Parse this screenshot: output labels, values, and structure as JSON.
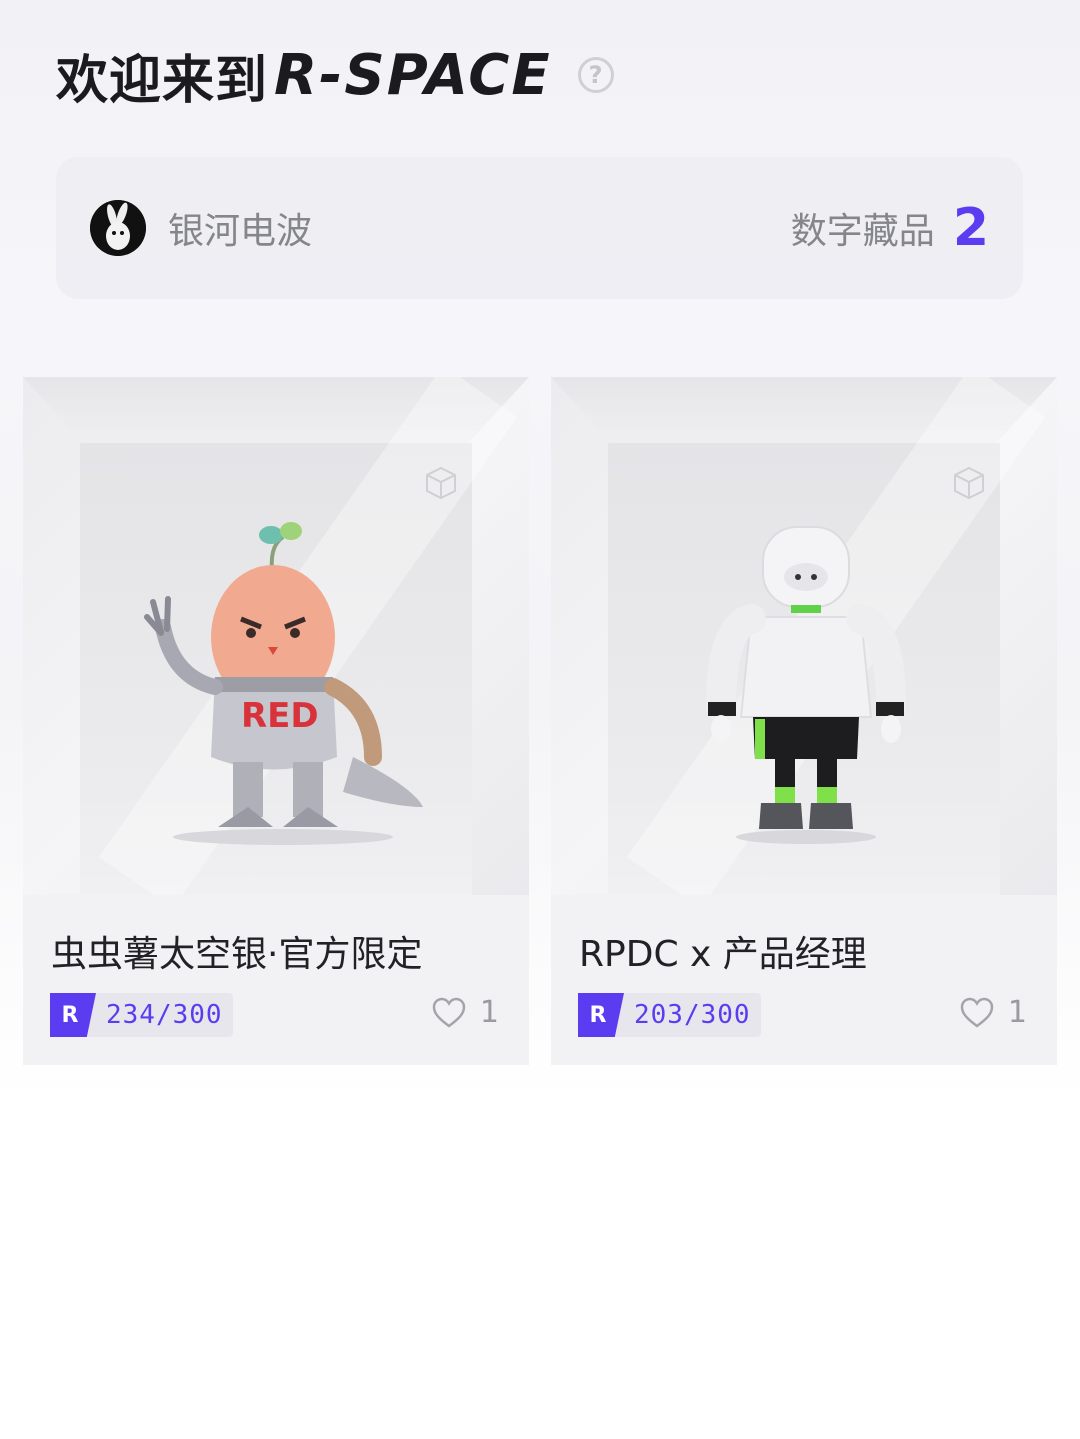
{
  "header": {
    "title_cn": "欢迎来到",
    "title_brand": "R-SPACE",
    "help_symbol": "?"
  },
  "profile": {
    "avatar_icon": "rabbit-avatar",
    "username": "银河电波",
    "collection_label": "数字藏品",
    "collection_count": "2"
  },
  "cards": [
    {
      "title": "虫虫薯太空银·官方限定",
      "badge_logo": "R",
      "edition": "234/300",
      "likes": "1",
      "figure_icon": "robot-dinosaur-figure"
    },
    {
      "title": "RPDC x 产品经理",
      "badge_logo": "R",
      "edition": "203/300",
      "likes": "1",
      "figure_icon": "white-hoodie-figure"
    }
  ],
  "colors": {
    "accent": "#5b3cf0",
    "text_dark": "#1b1b1f",
    "text_muted": "#85858c"
  }
}
